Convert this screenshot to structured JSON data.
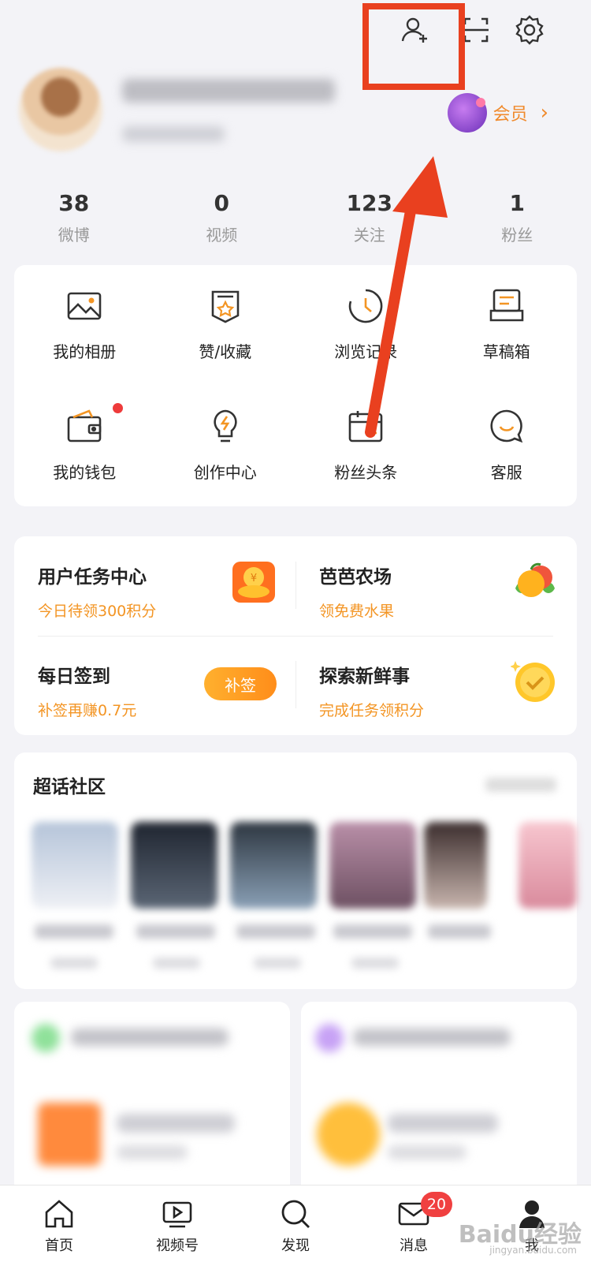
{
  "header": {
    "icons": [
      "add-friend-icon",
      "scan-icon",
      "settings-icon"
    ]
  },
  "profile": {
    "vip_label": "会员",
    "vip_arrow": "›"
  },
  "stats": [
    {
      "value": "38",
      "label": "微博"
    },
    {
      "value": "0",
      "label": "视频"
    },
    {
      "value": "123",
      "label": "关注"
    },
    {
      "value": "1",
      "label": "粉丝"
    }
  ],
  "grid": [
    {
      "label": "我的相册",
      "icon": "photo-album-icon"
    },
    {
      "label": "赞/收藏",
      "icon": "favorites-icon"
    },
    {
      "label": "浏览记录",
      "icon": "history-icon"
    },
    {
      "label": "草稿箱",
      "icon": "drafts-icon"
    },
    {
      "label": "我的钱包",
      "icon": "wallet-icon"
    },
    {
      "label": "创作中心",
      "icon": "creator-icon"
    },
    {
      "label": "粉丝头条",
      "icon": "calendar-icon"
    },
    {
      "label": "客服",
      "icon": "customer-service-icon"
    }
  ],
  "tasks": [
    {
      "title": "用户任务中心",
      "sub": "今日待领300积分"
    },
    {
      "title": "芭芭农场",
      "sub": "领免费水果"
    },
    {
      "title": "每日签到",
      "sub": "补签再赚0.7元",
      "button": "补签"
    },
    {
      "title": "探索新鲜事",
      "sub": "完成任务领积分"
    }
  ],
  "topic": {
    "title": "超话社区"
  },
  "tabbar": [
    {
      "label": "首页",
      "icon": "home-icon"
    },
    {
      "label": "视频号",
      "icon": "video-icon"
    },
    {
      "label": "发现",
      "icon": "discover-icon"
    },
    {
      "label": "消息",
      "icon": "message-icon",
      "badge": "20"
    },
    {
      "label": "我",
      "icon": "profile-icon"
    }
  ],
  "watermark": {
    "main": "Baidu经验",
    "sub": "jingyan.baidu.com"
  },
  "colors": {
    "accent": "#f39524",
    "annotation_red": "#e9401f",
    "badge_red": "#f04040"
  }
}
